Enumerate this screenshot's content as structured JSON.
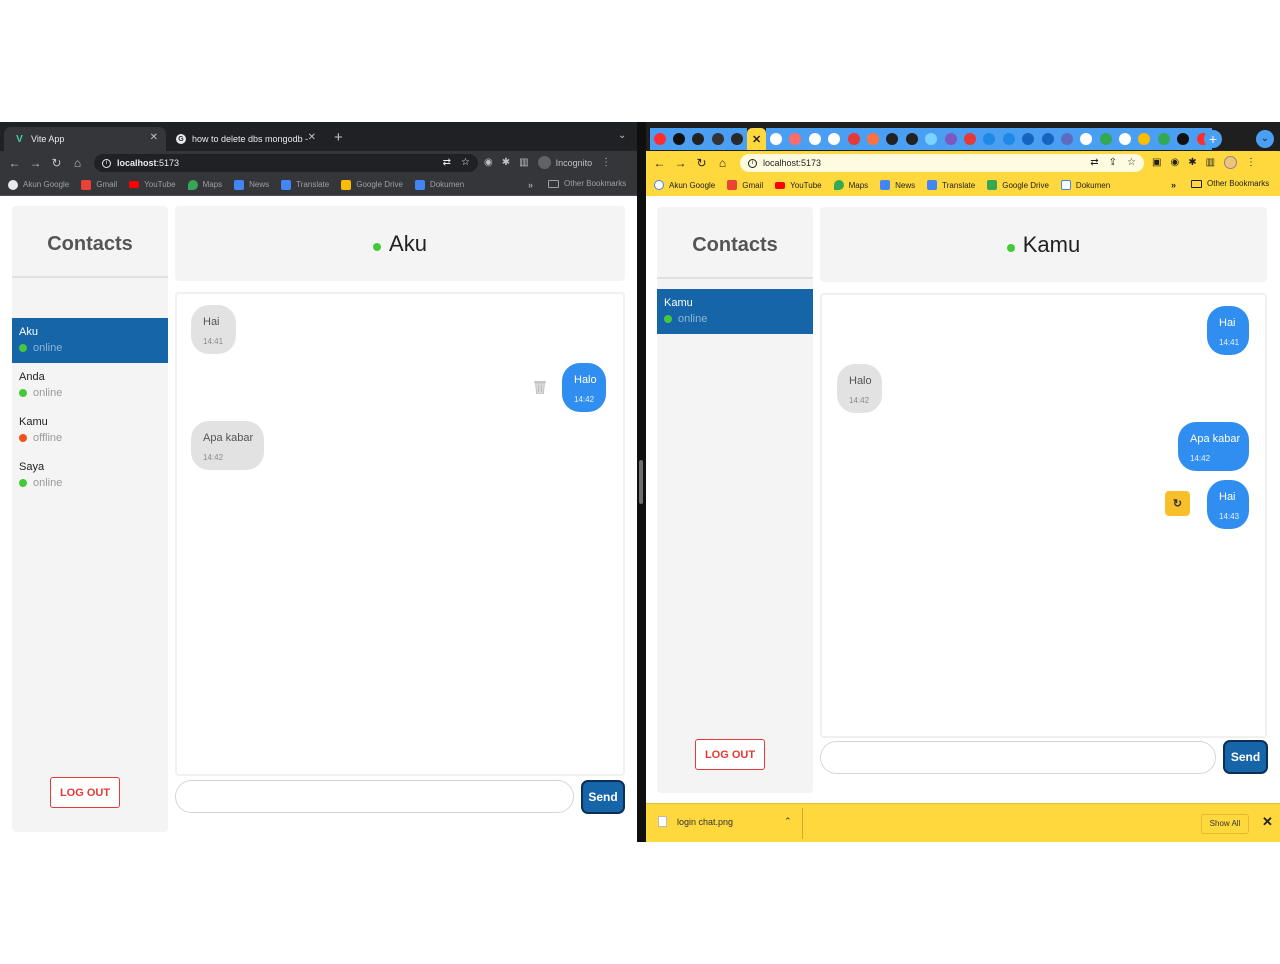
{
  "colors": {
    "online": "#44c93a",
    "offline": "#f4511e",
    "active_contact": "#1565a8",
    "sent_bubble": "#2f8ef0",
    "received_bubble": "#e2e2e2",
    "logout": "#e53935",
    "send_button": "#1565a8",
    "light_browser_theme": "#ffd83d",
    "dark_browser_theme": "#35363a"
  },
  "left_window": {
    "tabs": [
      {
        "title": "Vite App",
        "icon": "vite-logo-icon",
        "active": true
      },
      {
        "title": "how to delete dbs mongodb - Go",
        "icon": "google-icon",
        "active": false
      }
    ],
    "new_tab_label": "+",
    "address": {
      "host": "localhost",
      "port": ":5173"
    },
    "incognito_label": "Incognito",
    "bookmarks": [
      {
        "label": "Akun Google",
        "icon": "google-icon"
      },
      {
        "label": "Gmail",
        "icon": "gmail-icon"
      },
      {
        "label": "YouTube",
        "icon": "youtube-icon"
      },
      {
        "label": "Maps",
        "icon": "maps-icon"
      },
      {
        "label": "News",
        "icon": "news-icon"
      },
      {
        "label": "Translate",
        "icon": "translate-icon"
      },
      {
        "label": "Google Drive",
        "icon": "drive-icon"
      },
      {
        "label": "Dokumen",
        "icon": "docs-icon"
      }
    ],
    "bookmarks_more": "»",
    "other_bookmarks": "Other Bookmarks",
    "app": {
      "sidebar_title": "Contacts",
      "contacts": [
        {
          "name": "Aku",
          "status": "online",
          "active": true
        },
        {
          "name": "Anda",
          "status": "online",
          "active": false
        },
        {
          "name": "Kamu",
          "status": "offline",
          "active": false
        },
        {
          "name": "Saya",
          "status": "online",
          "active": false
        }
      ],
      "logout_label": "LOG OUT",
      "chat_title": "Aku",
      "chat_status": "online",
      "messages": [
        {
          "text": "Hai",
          "time": "14:41",
          "type": "received"
        },
        {
          "text": "Halo",
          "time": "14:42",
          "type": "sent",
          "action": "trash-icon"
        },
        {
          "text": "Apa kabar",
          "time": "14:42",
          "type": "received"
        }
      ],
      "input_value": "",
      "send_label": "Send"
    }
  },
  "right_window": {
    "pinned_tab_count": 30,
    "address": {
      "host": "localhost",
      "port": ":5173"
    },
    "bookmarks": [
      {
        "label": "Akun Google",
        "icon": "google-icon"
      },
      {
        "label": "Gmail",
        "icon": "gmail-icon"
      },
      {
        "label": "YouTube",
        "icon": "youtube-icon"
      },
      {
        "label": "Maps",
        "icon": "maps-icon"
      },
      {
        "label": "News",
        "icon": "news-icon"
      },
      {
        "label": "Translate",
        "icon": "translate-icon"
      },
      {
        "label": "Google Drive",
        "icon": "drive-icon"
      },
      {
        "label": "Dokumen",
        "icon": "docs-icon"
      }
    ],
    "bookmarks_more": "»",
    "other_bookmarks": "Other Bookmarks",
    "app": {
      "sidebar_title": "Contacts",
      "contacts": [
        {
          "name": "Kamu",
          "status": "online",
          "active": true
        }
      ],
      "logout_label": "LOG OUT",
      "chat_title": "Kamu",
      "chat_status": "online",
      "messages": [
        {
          "text": "Hai",
          "time": "14:41",
          "type": "sent"
        },
        {
          "text": "Halo",
          "time": "14:42",
          "type": "received"
        },
        {
          "text": "Apa kabar",
          "time": "14:42",
          "type": "sent"
        },
        {
          "text": "Hai",
          "time": "14:43",
          "type": "sent",
          "action": "refresh-icon"
        }
      ],
      "input_value": "",
      "send_label": "Send"
    },
    "download": {
      "filename": "login chat.png",
      "show_all_label": "Show All"
    }
  }
}
